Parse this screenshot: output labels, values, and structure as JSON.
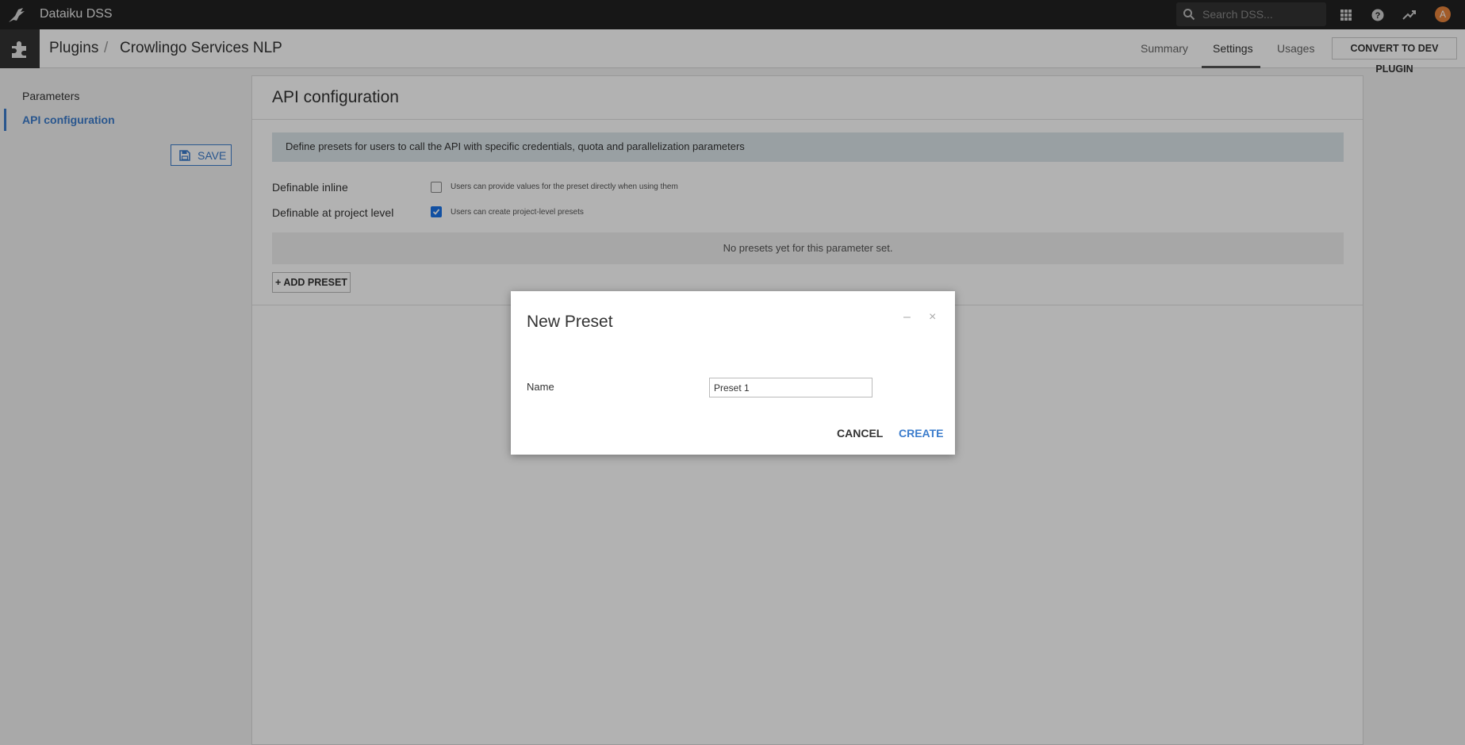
{
  "topbar": {
    "app_title": "Dataiku DSS",
    "search_placeholder": "Search DSS...",
    "avatar_letter": "A",
    "accent": "#e8843c"
  },
  "header": {
    "breadcrumb_root": "Plugins",
    "breadcrumb_separator": "/",
    "breadcrumb_current": "Crowlingo Services NLP",
    "tabs": [
      {
        "label": "Summary"
      },
      {
        "label": "Settings"
      },
      {
        "label": "Usages"
      }
    ],
    "active_tab": "Settings",
    "convert_label": "CONVERT TO DEV PLUGIN"
  },
  "sidebar": {
    "items": [
      {
        "label": "Parameters"
      },
      {
        "label": "API configuration"
      }
    ],
    "save_label": "SAVE"
  },
  "main": {
    "title": "API configuration",
    "info": "Define presets for users to call the API with specific credentials, quota and parallelization parameters",
    "rows": [
      {
        "label": "Definable inline",
        "hint": "Users can provide values for the preset directly when using them",
        "checked": false
      },
      {
        "label": "Definable at project level",
        "hint": "Users can create project-level presets",
        "checked": true
      }
    ],
    "empty_text": "No presets yet for this parameter set.",
    "add_label": "+ ADD PRESET"
  },
  "modal": {
    "title": "New Preset",
    "minimize_glyph": "–",
    "close_glyph": "×",
    "name_label": "Name",
    "name_value": "Preset 1",
    "cancel_label": "CANCEL",
    "create_label": "CREATE"
  }
}
